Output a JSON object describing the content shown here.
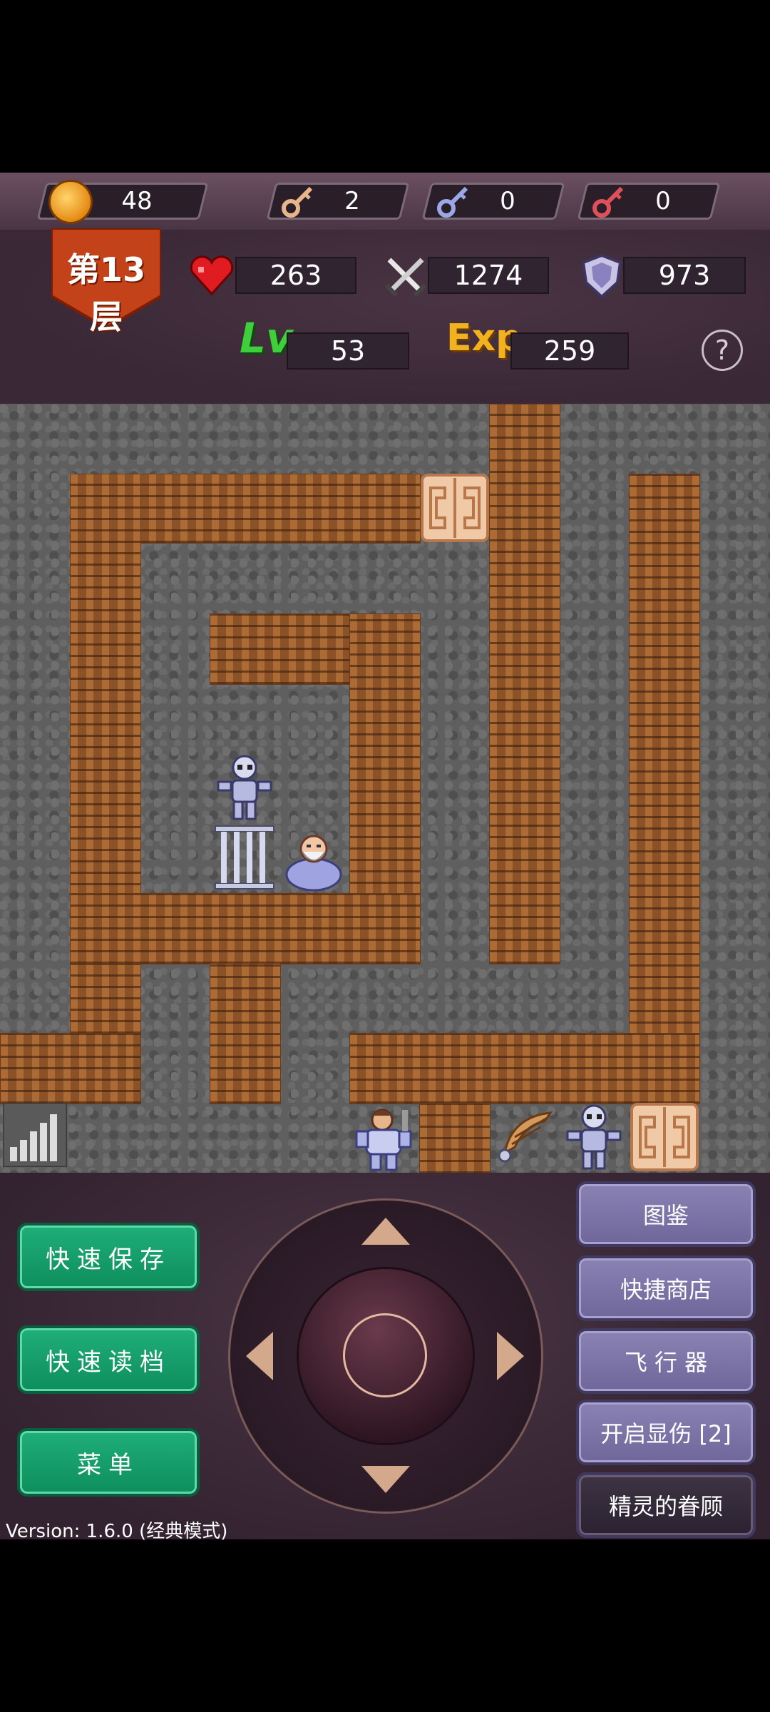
{
  "resources": {
    "gold": "48",
    "yellow_keys": "2",
    "blue_keys": "0",
    "red_keys": "0"
  },
  "floor": {
    "label": "第13层"
  },
  "stats": {
    "hp": "263",
    "attack": "1274",
    "defense": "973",
    "level_label": "Lv",
    "level": "53",
    "exp_label": "Exp",
    "exp": "259",
    "help": "?"
  },
  "colors": {
    "save_button": "#109a68",
    "side_button": "#7c74a8",
    "brick": "#9b5d2d",
    "stone": "#5f5f5f"
  },
  "map": {
    "sprites": [
      "door-icon",
      "skeleton-icon",
      "iron-gate-icon",
      "old-sage-icon",
      "hero-icon",
      "wing-item-icon",
      "skeleton-icon",
      "door-icon",
      "signal-icon"
    ]
  },
  "buttons": {
    "quick_save": "快速保存",
    "quick_load": "快速读档",
    "menu": "菜单",
    "bestiary": "图鉴",
    "quick_shop": "快捷商店",
    "flyer": "飞 行 器",
    "show_damage": "开启显伤 [2]",
    "spirit_blessing": "精灵的眷顾"
  },
  "version": "Version: 1.6.0 (经典模式)"
}
